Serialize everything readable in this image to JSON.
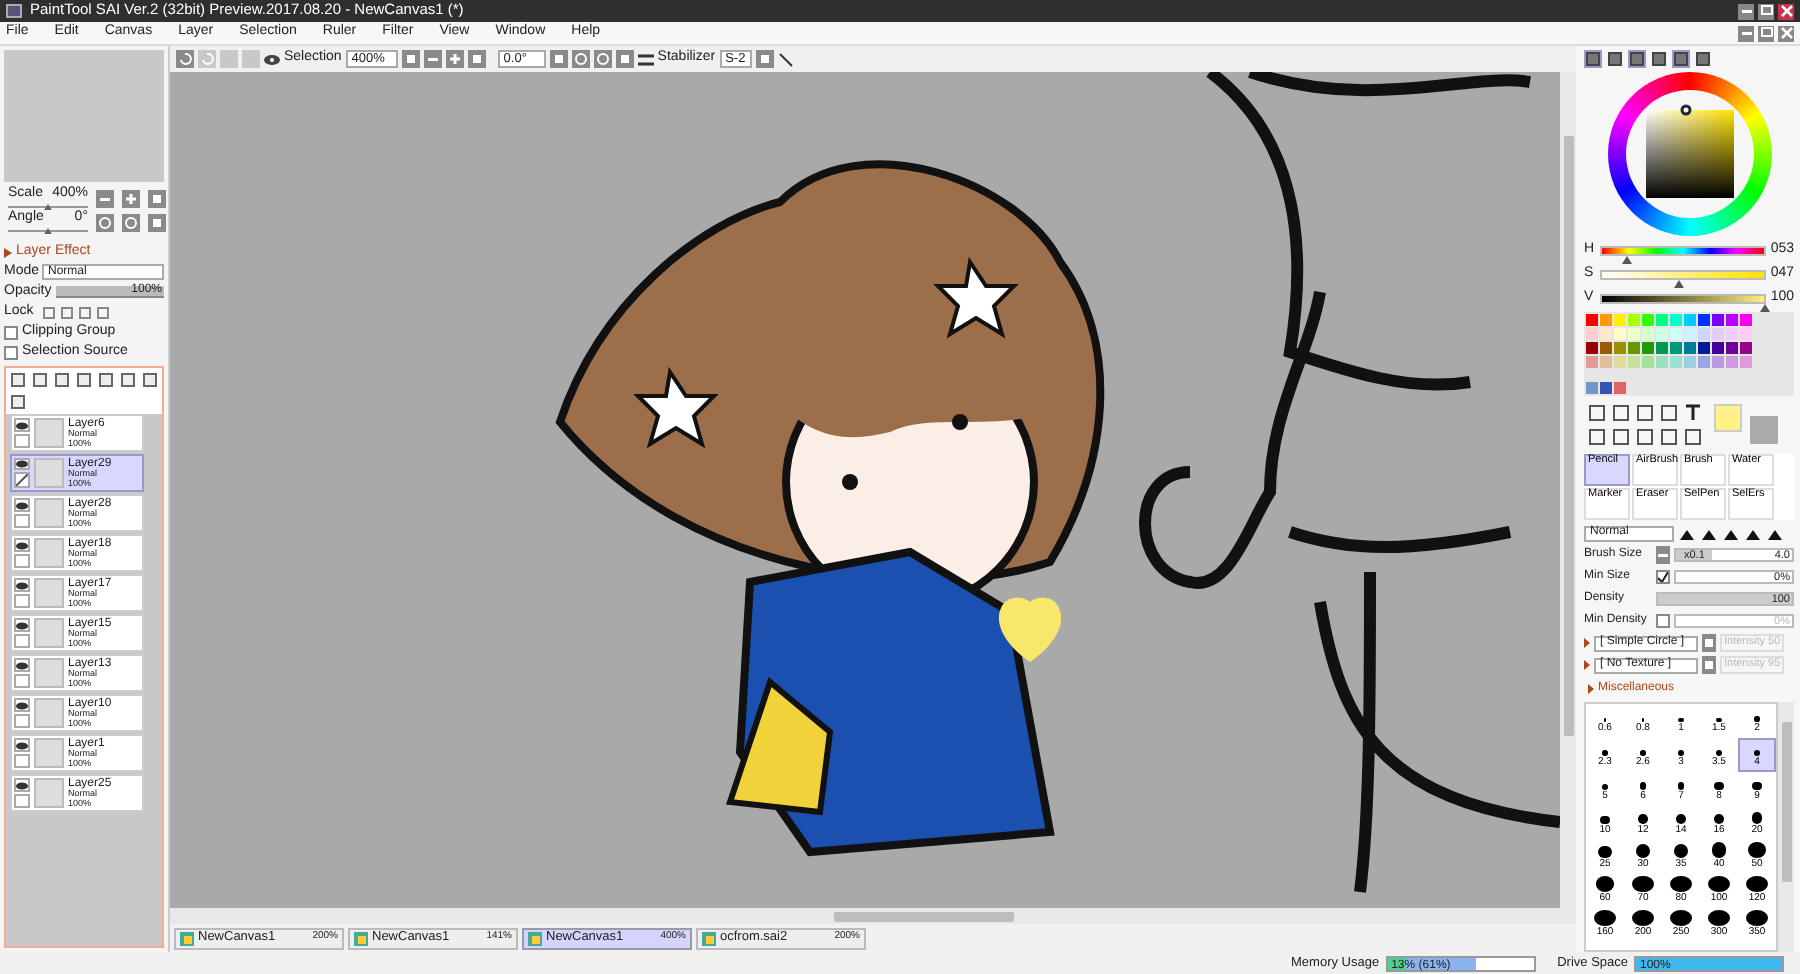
{
  "window": {
    "title": "PaintTool SAI Ver.2 (32bit) Preview.2017.08.20 - NewCanvas1 (*)"
  },
  "menu": [
    "File",
    "Edit",
    "Canvas",
    "Layer",
    "Selection",
    "Ruler",
    "Filter",
    "View",
    "Window",
    "Help"
  ],
  "toolbar": {
    "selection_label": "Selection",
    "zoom": "400%",
    "angle": "0.0°",
    "stabilizer_label": "Stabilizer",
    "stabilizer": "S-2"
  },
  "navigator": {
    "scale_label": "Scale",
    "scale": "400%",
    "angle_label": "Angle",
    "angle": "0°"
  },
  "layer_effect": {
    "title": "Layer Effect",
    "expanded": false
  },
  "layer_props": {
    "mode_label": "Mode",
    "mode": "Normal",
    "opacity_label": "Opacity",
    "opacity": "100%",
    "level": 1,
    "lock_label": "Lock",
    "options": [
      {
        "label": "Clipping Group",
        "checked": false
      },
      {
        "label": "Selection Source",
        "checked": false
      }
    ]
  },
  "layers": [
    {
      "name": "Layer6",
      "mode": "Normal",
      "opacity": "100%",
      "visible": true,
      "selected": false
    },
    {
      "name": "Layer29",
      "mode": "Normal",
      "opacity": "100%",
      "visible": true,
      "selected": true
    },
    {
      "name": "Layer28",
      "mode": "Normal",
      "opacity": "100%",
      "visible": true,
      "selected": false
    },
    {
      "name": "Layer18",
      "mode": "Normal",
      "opacity": "100%",
      "visible": true,
      "selected": false
    },
    {
      "name": "Layer17",
      "mode": "Normal",
      "opacity": "100%",
      "visible": true,
      "selected": false
    },
    {
      "name": "Layer15",
      "mode": "Normal",
      "opacity": "100%",
      "visible": true,
      "selected": false
    },
    {
      "name": "Layer13",
      "mode": "Normal",
      "opacity": "100%",
      "visible": true,
      "selected": false
    },
    {
      "name": "Layer10",
      "mode": "Normal",
      "opacity": "100%",
      "visible": true,
      "selected": false
    },
    {
      "name": "Layer1",
      "mode": "Normal",
      "opacity": "100%",
      "visible": true,
      "selected": false
    },
    {
      "name": "Layer25",
      "mode": "Normal",
      "opacity": "100%",
      "visible": true,
      "selected": false
    }
  ],
  "color_tabs": [
    {
      "on": true
    },
    {
      "on": false
    },
    {
      "on": true
    },
    {
      "on": false
    },
    {
      "on": true
    },
    {
      "on": false
    }
  ],
  "hsv": [
    {
      "label": "H",
      "value": "053",
      "level": 0.147
    },
    {
      "label": "S",
      "value": "047",
      "level": 0.47
    },
    {
      "label": "V",
      "value": "100",
      "level": 1
    }
  ],
  "palette": [
    {
      "swatches": [
        {
          "color": "#ff0000"
        },
        {
          "color": "#ff9900"
        },
        {
          "color": "#ffee00"
        },
        {
          "color": "#aaff00"
        },
        {
          "color": "#33ff00"
        },
        {
          "color": "#00ff88"
        },
        {
          "color": "#00ffcc"
        },
        {
          "color": "#00ccff"
        },
        {
          "color": "#0033ff"
        },
        {
          "color": "#7700ff"
        },
        {
          "color": "#bb00ff"
        },
        {
          "color": "#ff00ee"
        }
      ]
    },
    {
      "swatches": [
        {
          "color": "#ffcccc"
        },
        {
          "color": "#ffe6cc"
        },
        {
          "color": "#fffbcc"
        },
        {
          "color": "#eeffcc"
        },
        {
          "color": "#d6ffcc"
        },
        {
          "color": "#ccffe6"
        },
        {
          "color": "#ccfff5"
        },
        {
          "color": "#ccf2ff"
        },
        {
          "color": "#ccd6ff"
        },
        {
          "color": "#e4ccff"
        },
        {
          "color": "#f1ccff"
        },
        {
          "color": "#ffccf9"
        }
      ]
    },
    {
      "swatches": [
        {
          "color": "#990000"
        },
        {
          "color": "#995c00"
        },
        {
          "color": "#998f00"
        },
        {
          "color": "#669900"
        },
        {
          "color": "#1f9900"
        },
        {
          "color": "#009952"
        },
        {
          "color": "#00997a"
        },
        {
          "color": "#007a99"
        },
        {
          "color": "#001f99"
        },
        {
          "color": "#470099"
        },
        {
          "color": "#700099"
        },
        {
          "color": "#99008f"
        }
      ]
    },
    {
      "swatches": [
        {
          "color": "#e09a9a"
        },
        {
          "color": "#e0c09a"
        },
        {
          "color": "#e0db9a"
        },
        {
          "color": "#c6e09a"
        },
        {
          "color": "#a6e09a"
        },
        {
          "color": "#9ae0bd"
        },
        {
          "color": "#9ae0d3"
        },
        {
          "color": "#9ad0e0"
        },
        {
          "color": "#9aa6e0"
        },
        {
          "color": "#b99ae0"
        },
        {
          "color": "#cd9ae0"
        },
        {
          "color": "#e09adb"
        }
      ]
    },
    {
      "swatches": [
        {
          "color": "#7094c4"
        },
        {
          "color": "#3454b4"
        },
        {
          "color": "#e06464"
        }
      ]
    }
  ],
  "tools": [
    {
      "label": "Pencil",
      "selected": true
    },
    {
      "label": "AirBrush",
      "selected": false
    },
    {
      "label": "Brush",
      "selected": false
    },
    {
      "label": "Water",
      "selected": false
    },
    {
      "label": "Marker",
      "selected": false
    },
    {
      "label": "Eraser",
      "selected": false
    },
    {
      "label": "SelPen",
      "selected": false
    },
    {
      "label": "SelErs",
      "selected": false
    }
  ],
  "brush": {
    "mode": "Normal",
    "size_label": "Brush Size",
    "multiplier": "x0.1",
    "size": "4.0",
    "min_size_label": "Min Size",
    "min_size": "0%",
    "min_size_checked": true,
    "density": {
      "label": "Density",
      "value": "100",
      "level": 1
    },
    "min_density_label": "Min Density",
    "min_density": "0%",
    "min_density_checked": false,
    "shape": "[ Simple Circle ]",
    "shape_intensity": "Intensity 50",
    "texture": "[ No Texture ]",
    "texture_intensity": "Intensity 95",
    "misc": "Miscellaneous"
  },
  "brush_sizes": [
    {
      "label": "0.6",
      "selected": false
    },
    {
      "label": "0.8",
      "selected": false
    },
    {
      "label": "1",
      "selected": false
    },
    {
      "label": "1.5",
      "selected": false
    },
    {
      "label": "2",
      "selected": false
    },
    {
      "label": "2.3",
      "selected": false
    },
    {
      "label": "2.6",
      "selected": false
    },
    {
      "label": "3",
      "selected": false
    },
    {
      "label": "3.5",
      "selected": false
    },
    {
      "label": "4",
      "selected": true
    },
    {
      "label": "5",
      "selected": false
    },
    {
      "label": "6",
      "selected": false
    },
    {
      "label": "7",
      "selected": false
    },
    {
      "label": "8",
      "selected": false
    },
    {
      "label": "9",
      "selected": false
    },
    {
      "label": "10",
      "selected": false
    },
    {
      "label": "12",
      "selected": false
    },
    {
      "label": "14",
      "selected": false
    },
    {
      "label": "16",
      "selected": false
    },
    {
      "label": "20",
      "selected": false
    },
    {
      "label": "25",
      "selected": false
    },
    {
      "label": "30",
      "selected": false
    },
    {
      "label": "35",
      "selected": false
    },
    {
      "label": "40",
      "selected": false
    },
    {
      "label": "50",
      "selected": false
    },
    {
      "label": "60",
      "selected": false
    },
    {
      "label": "70",
      "selected": false
    },
    {
      "label": "80",
      "selected": false
    },
    {
      "label": "100",
      "selected": false
    },
    {
      "label": "120",
      "selected": false
    },
    {
      "label": "160",
      "selected": false
    },
    {
      "label": "200",
      "selected": false
    },
    {
      "label": "250",
      "selected": false
    },
    {
      "label": "300",
      "selected": false
    },
    {
      "label": "350",
      "selected": false
    }
  ],
  "canvas_tabs": [
    {
      "name": "NewCanvas1",
      "zoom": "200%",
      "selected": false
    },
    {
      "name": "NewCanvas1",
      "zoom": "141%",
      "selected": false
    },
    {
      "name": "NewCanvas1",
      "zoom": "400%",
      "selected": true
    },
    {
      "name": "ocfrom.sai2",
      "zoom": "200%",
      "selected": false
    }
  ],
  "status_bar": {
    "memory": {
      "label": "Memory Usage",
      "value": "13% (61%)",
      "level": 0.61
    },
    "drive": {
      "label": "Drive Space",
      "value": "100%",
      "level": 1
    }
  }
}
